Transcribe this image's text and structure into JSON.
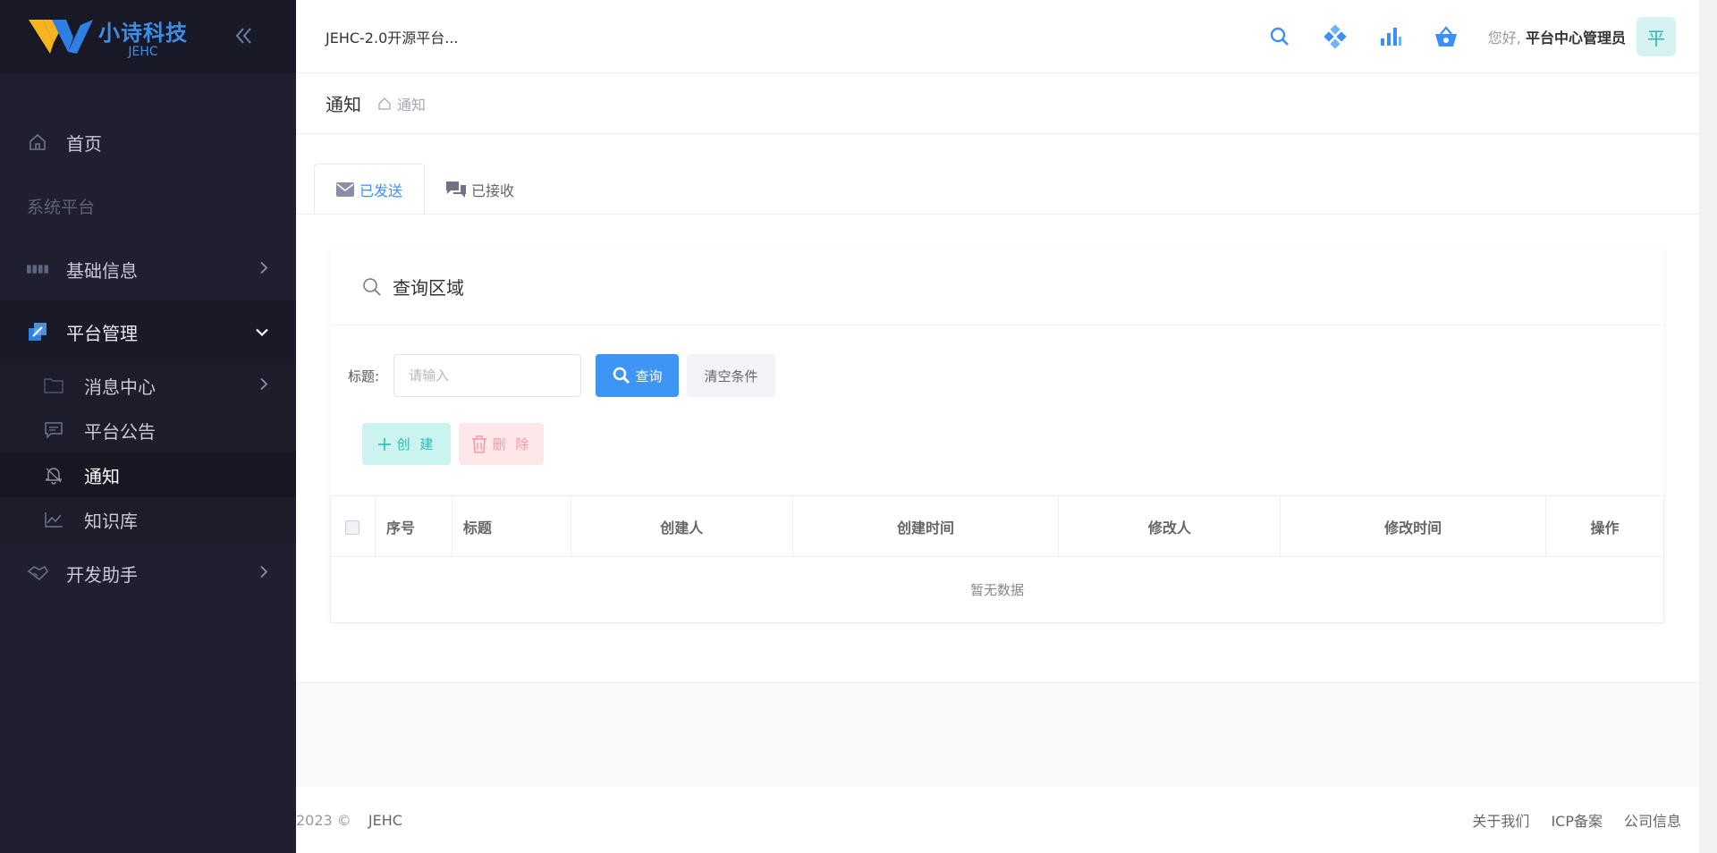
{
  "brand": {
    "name_cn": "小诗科技",
    "name_en": "JEHC"
  },
  "header": {
    "app_title": "JEHC-2.0开源平台...",
    "greeting_prefix": "您好,",
    "user_name": "平台中心管理员",
    "avatar_text": "平",
    "icons": [
      "search-icon",
      "diamond-grid-icon",
      "bar-chart-icon",
      "basket-icon"
    ],
    "accent": "#3e8ef7"
  },
  "sidebar": {
    "home": "首页",
    "section_label": "系统平台",
    "basic_info": "基础信息",
    "platform_mgmt": "平台管理",
    "sub_items": {
      "message_center": "消息中心",
      "announcement": "平台公告",
      "notice": "通知",
      "knowledge": "知识库"
    },
    "dev_helper": "开发助手"
  },
  "breadcrumb": {
    "page_title": "通知",
    "crumb": "通知"
  },
  "tabs": {
    "sent": "已发送",
    "received": "已接收"
  },
  "query": {
    "title": "查询区域",
    "field_label": "标题:",
    "field_placeholder": "请输入",
    "search_button": "查询",
    "clear_button": "清空条件"
  },
  "actions": {
    "create": "创 建",
    "delete": "删 除"
  },
  "table": {
    "columns": [
      "序号",
      "标题",
      "创建人",
      "创建时间",
      "修改人",
      "修改时间",
      "操作"
    ],
    "empty_text": "暂无数据"
  },
  "footer": {
    "copyright": "2023 ©",
    "brand": "JEHC",
    "links": [
      "关于我们",
      "ICP备案",
      "公司信息"
    ]
  }
}
